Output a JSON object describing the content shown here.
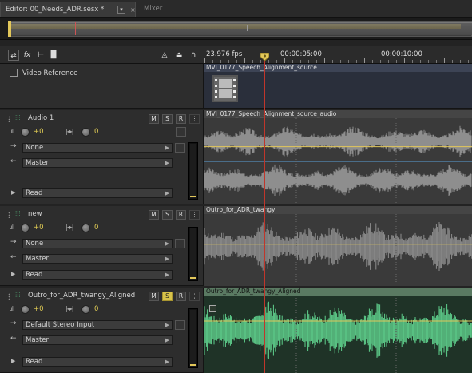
{
  "tabs": {
    "editor_label": "Editor: 00_Needs_ADR.sesx *",
    "mixer_label": "Mixer"
  },
  "ruler": {
    "fps": "23.976 fps",
    "t1": "00:00:05:00",
    "t2": "00:00:10:00"
  },
  "video_track": {
    "label": "Video Reference",
    "clip_name": "MVI_0177_Speech_Alignment_source"
  },
  "tracks": [
    {
      "name": "Audio 1",
      "volume": "+0",
      "pan": "0",
      "input": "None",
      "output": "Master",
      "automation": "Read",
      "solo_active": false,
      "clip_name": "MVI_0177_Speech_Alignment_source_audio",
      "waveform_color": "#8e8e8e"
    },
    {
      "name": "new",
      "volume": "+0",
      "pan": "0",
      "input": "None",
      "output": "Master",
      "automation": "Read",
      "solo_active": false,
      "clip_name": "Outro_for_ADR_twangy",
      "waveform_color": "#8e8e8e"
    },
    {
      "name": "Outro_for_ADR_twangy_Aligned",
      "volume": "+0",
      "pan": "0",
      "input": "Default Stereo Input",
      "output": "Master",
      "automation": "Read",
      "solo_active": true,
      "clip_name": "Outro_for_ADR_twangy_Aligned",
      "waveform_color": "#5fd08c"
    }
  ],
  "buttons": {
    "mute": "M",
    "solo": "S",
    "record": "R",
    "more": "⋮"
  },
  "icons": {
    "switch": "switch-arrows-icon",
    "fx": "fx-icon",
    "sends": "sends-icon",
    "eq": "eq-icon",
    "metronome": "metronome-icon",
    "headphones": "headphones-icon"
  },
  "colors": {
    "accent": "#e2c75a",
    "playhead": "#c0362b",
    "selected_clip": "#5fd08c"
  }
}
